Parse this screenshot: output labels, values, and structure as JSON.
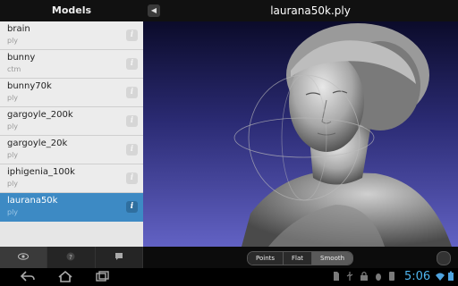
{
  "sidebar": {
    "title": "Models",
    "collapse_icon": "chevron-left-icon",
    "items": [
      {
        "name": "brain",
        "ext": "ply",
        "selected": false
      },
      {
        "name": "bunny",
        "ext": "ctm",
        "selected": false
      },
      {
        "name": "bunny70k",
        "ext": "ply",
        "selected": false
      },
      {
        "name": "gargoyle_200k",
        "ext": "ply",
        "selected": false
      },
      {
        "name": "gargoyle_20k",
        "ext": "ply",
        "selected": false
      },
      {
        "name": "iphigenia_100k",
        "ext": "ply",
        "selected": false
      },
      {
        "name": "laurana50k",
        "ext": "ply",
        "selected": true
      }
    ],
    "tabs": [
      {
        "icon": "eye-icon",
        "active": true
      },
      {
        "icon": "help-icon",
        "active": false
      },
      {
        "icon": "comment-icon",
        "active": false
      }
    ]
  },
  "viewer": {
    "title": "laurana50k.ply",
    "background_top": "#0b0b2a",
    "background_bottom": "#6262c4"
  },
  "render_modes": {
    "options": [
      "Points",
      "Flat",
      "Smooth"
    ],
    "selected": "Smooth"
  },
  "system_bar": {
    "clock": "5:06",
    "accent": "#4fb6f0"
  }
}
